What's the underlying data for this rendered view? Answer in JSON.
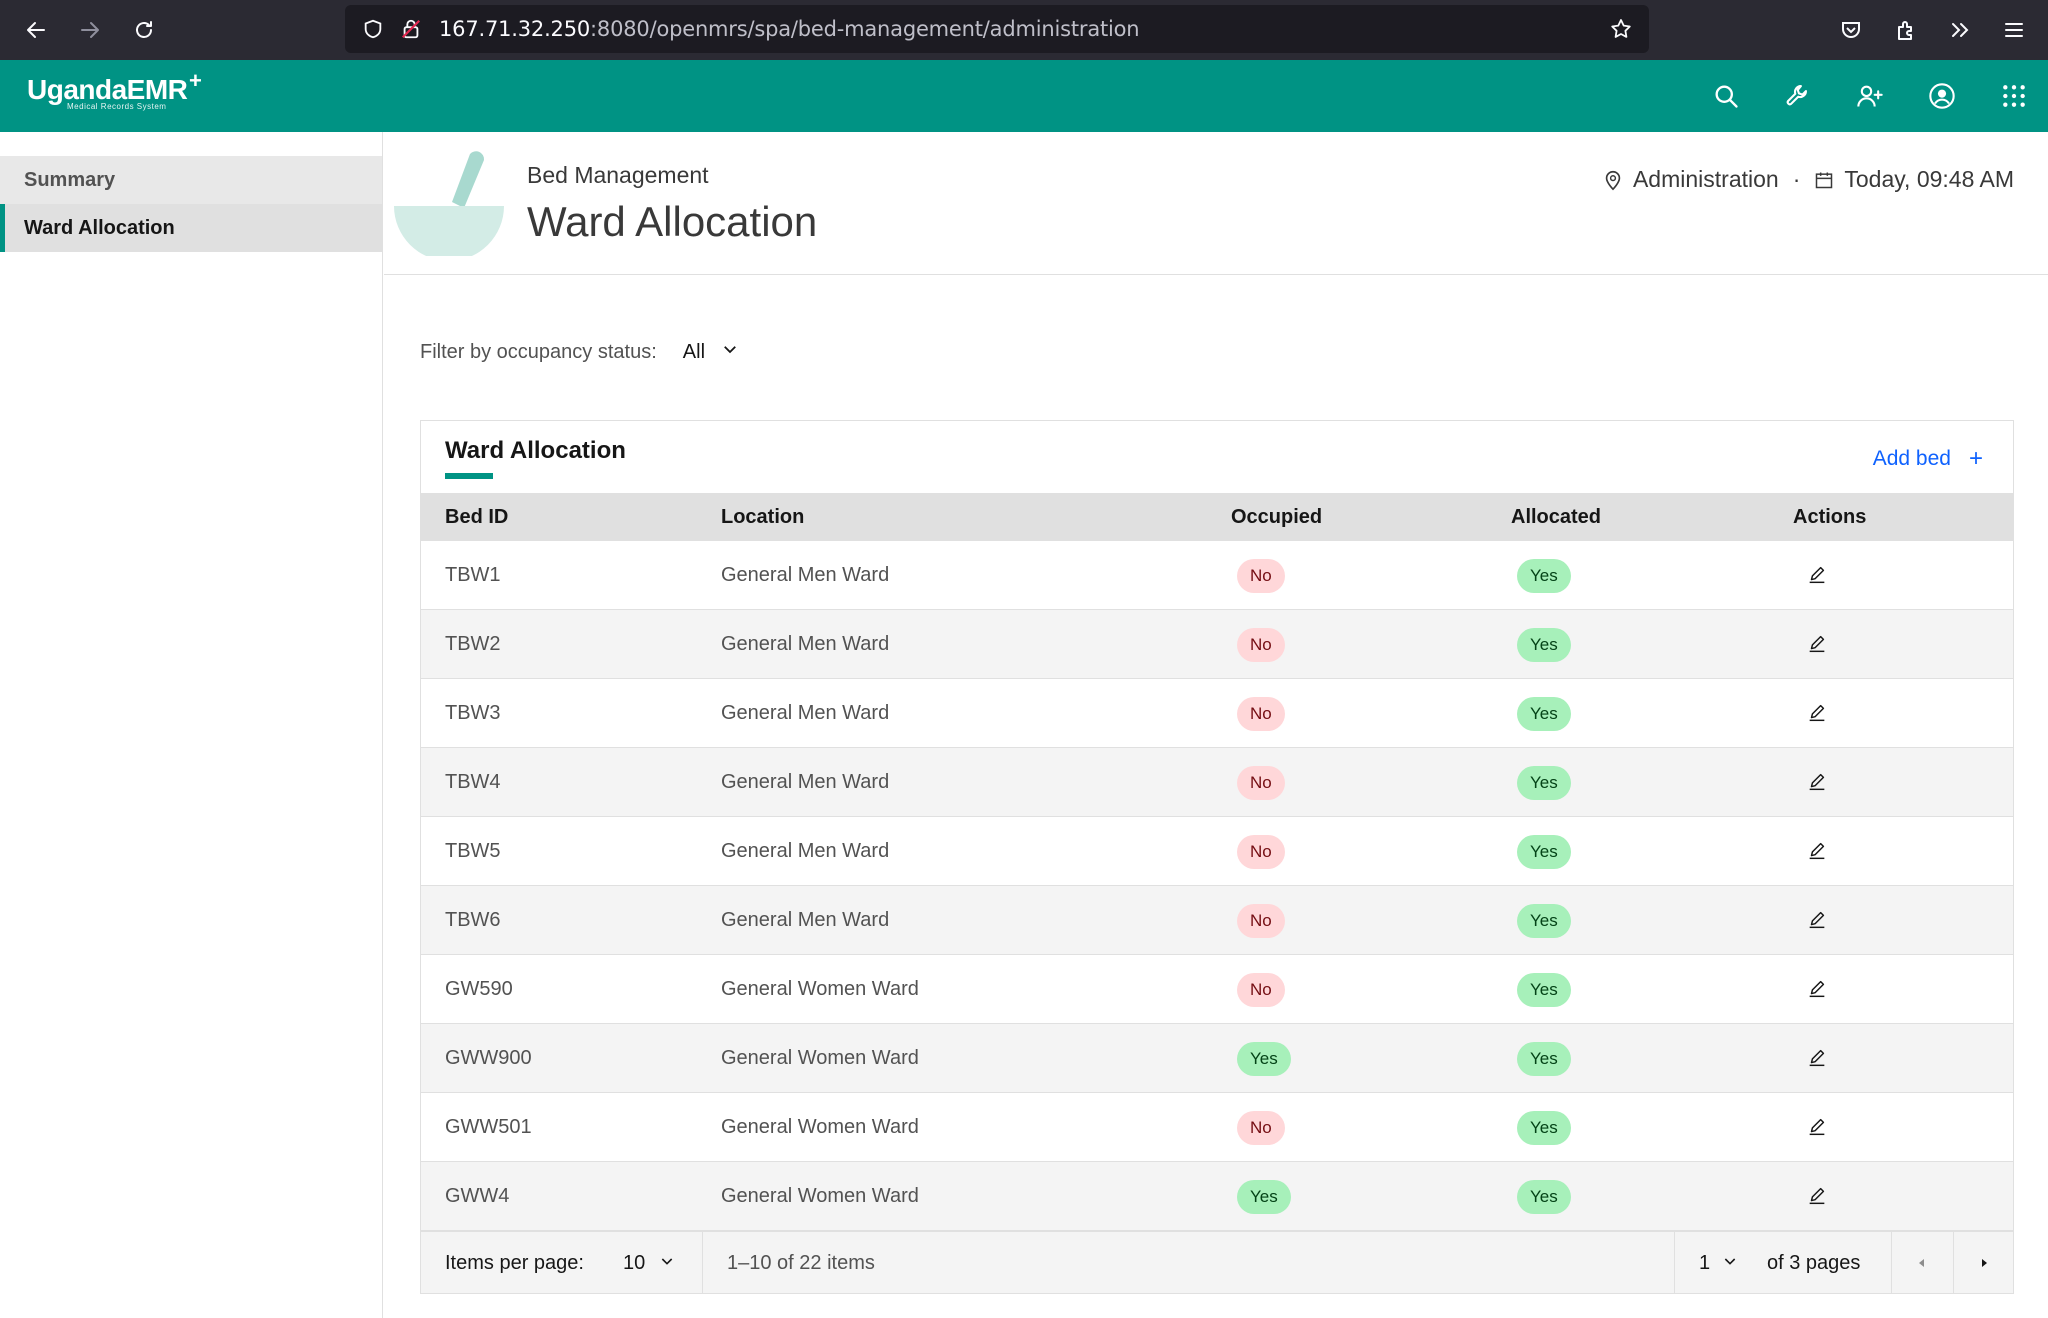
{
  "browser": {
    "url_host": "167.71.32.250",
    "url_rest": ":8080/openmrs/spa/bed-management/administration"
  },
  "header": {
    "logo_text": "UgandaEMR",
    "logo_tagline": "Medical Records System",
    "brand_color": "#009384",
    "icons": [
      "search-icon",
      "wrench-icon",
      "add-user-icon",
      "user-avatar-icon",
      "app-switcher-icon"
    ]
  },
  "sidebar": {
    "items": [
      {
        "label": "Summary",
        "active": false
      },
      {
        "label": "Ward Allocation",
        "active": true
      }
    ]
  },
  "page": {
    "subtitle": "Bed Management",
    "title": "Ward Allocation",
    "location": "Administration",
    "separator": "·",
    "datetime": "Today, 09:48 AM"
  },
  "filter": {
    "label": "Filter by occupancy status:",
    "value": "All"
  },
  "table": {
    "title": "Ward Allocation",
    "add_label": "Add bed",
    "add_symbol": "+",
    "columns": [
      "Bed ID",
      "Location",
      "Occupied",
      "Allocated",
      "Actions"
    ],
    "rows": [
      {
        "bed_id": "TBW1",
        "location": "General Men Ward",
        "occupied": "No",
        "allocated": "Yes"
      },
      {
        "bed_id": "TBW2",
        "location": "General Men Ward",
        "occupied": "No",
        "allocated": "Yes"
      },
      {
        "bed_id": "TBW3",
        "location": "General Men Ward",
        "occupied": "No",
        "allocated": "Yes"
      },
      {
        "bed_id": "TBW4",
        "location": "General Men Ward",
        "occupied": "No",
        "allocated": "Yes"
      },
      {
        "bed_id": "TBW5",
        "location": "General Men Ward",
        "occupied": "No",
        "allocated": "Yes"
      },
      {
        "bed_id": "TBW6",
        "location": "General Men Ward",
        "occupied": "No",
        "allocated": "Yes"
      },
      {
        "bed_id": "GW590",
        "location": "General Women Ward",
        "occupied": "No",
        "allocated": "Yes"
      },
      {
        "bed_id": "GWW900",
        "location": "General Women Ward",
        "occupied": "Yes",
        "allocated": "Yes"
      },
      {
        "bed_id": "GWW501",
        "location": "General Women Ward",
        "occupied": "No",
        "allocated": "Yes"
      },
      {
        "bed_id": "GWW4",
        "location": "General Women Ward",
        "occupied": "Yes",
        "allocated": "Yes"
      }
    ]
  },
  "pagination": {
    "items_per_page_label": "Items per page:",
    "items_per_page": "10",
    "range": "1–10 of 22 items",
    "current_page": "1",
    "total_pages_label": "of 3 pages"
  }
}
